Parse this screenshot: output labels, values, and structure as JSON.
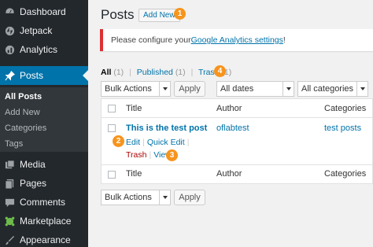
{
  "sidebar": {
    "items": [
      {
        "label": "Dashboard",
        "icon": "dashboard-icon"
      },
      {
        "label": "Jetpack",
        "icon": "jetpack-icon"
      },
      {
        "label": "Analytics",
        "icon": "analytics-icon"
      },
      {
        "label": "Posts",
        "icon": "pin-icon"
      },
      {
        "label": "Media",
        "icon": "media-icon"
      },
      {
        "label": "Pages",
        "icon": "pages-icon"
      },
      {
        "label": "Comments",
        "icon": "comments-icon"
      },
      {
        "label": "Marketplace",
        "icon": "marketplace-icon"
      },
      {
        "label": "Appearance",
        "icon": "appearance-icon"
      }
    ],
    "submenu": [
      "All Posts",
      "Add New",
      "Categories",
      "Tags"
    ]
  },
  "header": {
    "title": "Posts",
    "add_new": "Add New"
  },
  "badges": [
    "1",
    "2",
    "3",
    "4"
  ],
  "notice": {
    "text": "Please configure your ",
    "link": "Google Analytics settings",
    "suffix": "!"
  },
  "filters": {
    "all": "All",
    "all_count": "(1)",
    "published": "Published",
    "published_count": "(1)",
    "trash": "Trash",
    "trash_count": "(1)",
    "separator": "|"
  },
  "toolbar": {
    "bulk_actions": "Bulk Actions",
    "apply": "Apply",
    "dates": "All dates",
    "categories": "All categories"
  },
  "table": {
    "columns": {
      "title": "Title",
      "author": "Author",
      "categories": "Categories"
    },
    "rows": [
      {
        "title": "This is the test post",
        "author": "oflabtest",
        "categories": "test posts",
        "actions": {
          "edit": "Edit",
          "quick_edit": "Quick Edit",
          "trash": "Trash",
          "view": "View"
        }
      }
    ]
  },
  "colors": {
    "sidebar": "#23282d",
    "accent": "#0073aa",
    "badge": "#f7941d",
    "notice_border": "#dc3232"
  }
}
